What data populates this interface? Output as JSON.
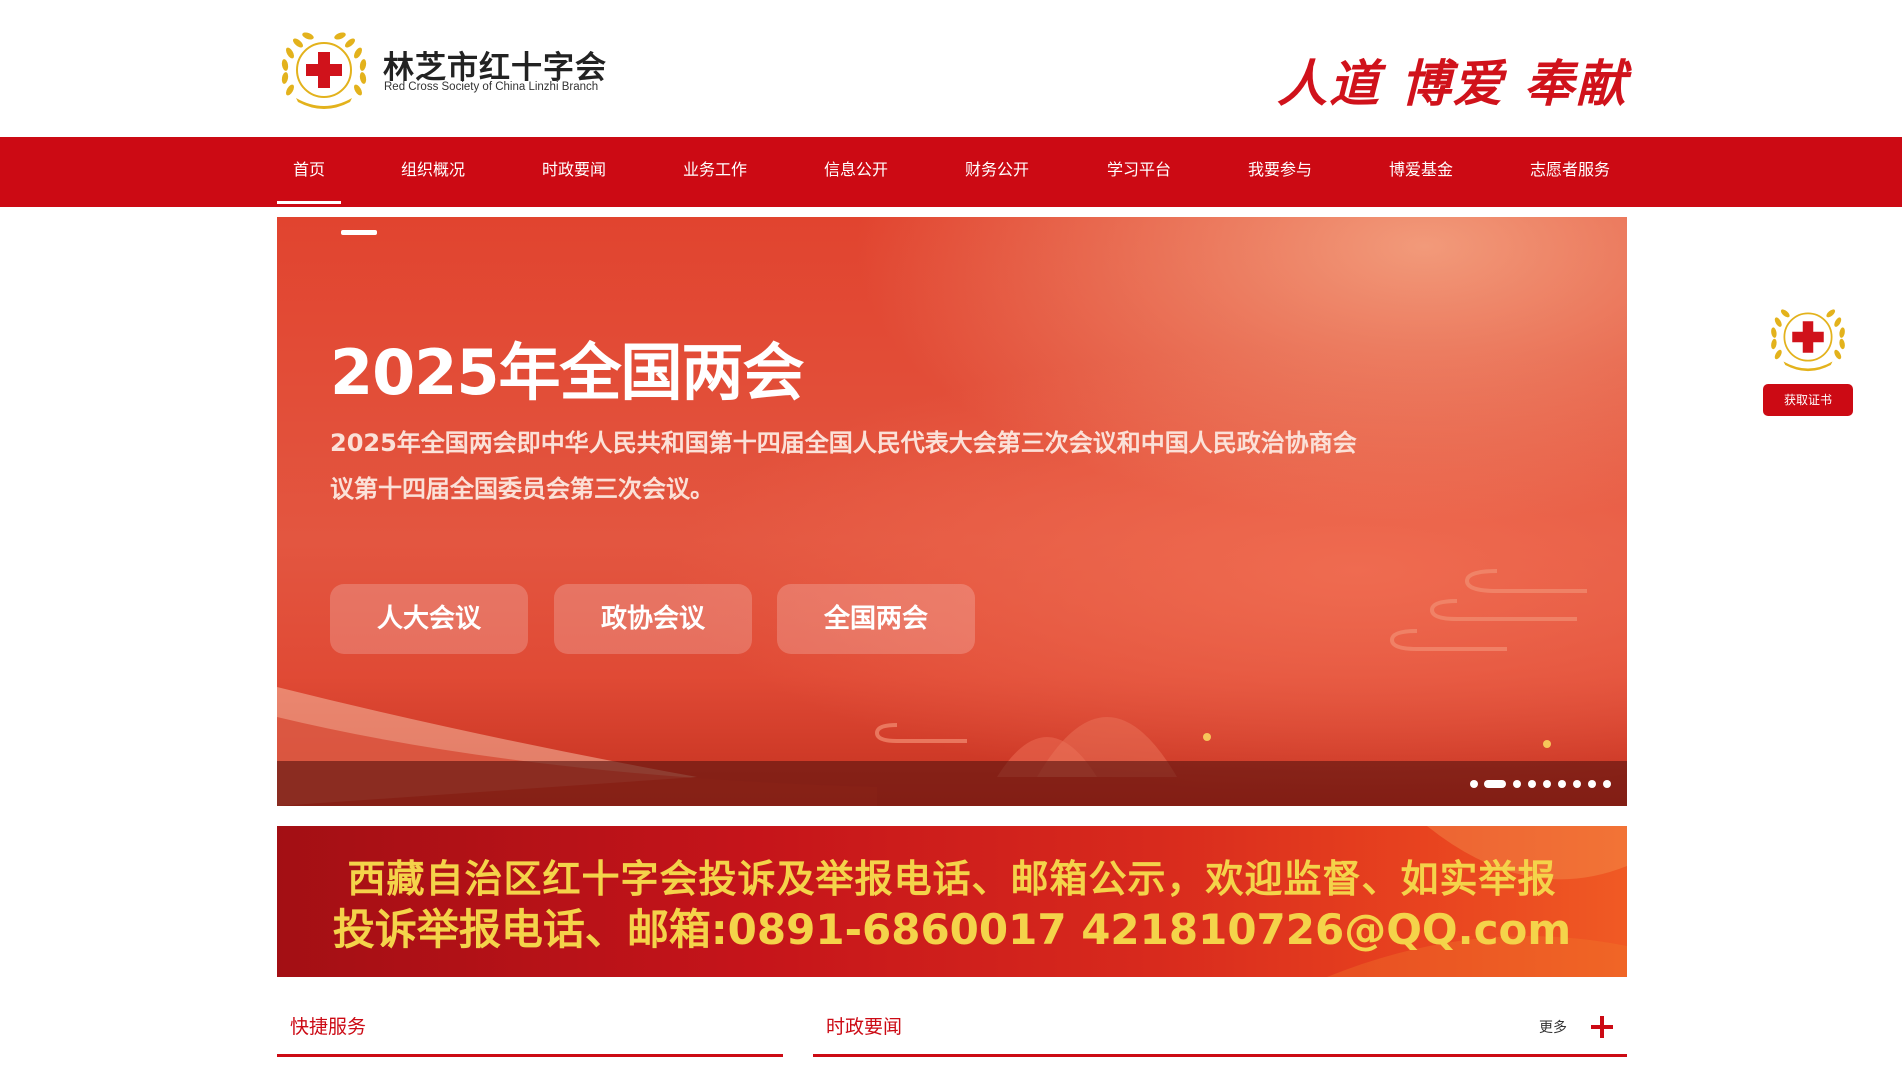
{
  "header": {
    "logo_cn": "林芝市红十字会",
    "logo_en": "Red Cross Society of China Linzhi Branch",
    "slogan": "人道 博爱 奉献"
  },
  "nav": {
    "items": [
      {
        "label": "首页",
        "active": true
      },
      {
        "label": "组织概况"
      },
      {
        "label": "时政要闻"
      },
      {
        "label": "业务工作"
      },
      {
        "label": "信息公开"
      },
      {
        "label": "财务公开"
      },
      {
        "label": "学习平台"
      },
      {
        "label": "我要参与"
      },
      {
        "label": "博爱基金"
      },
      {
        "label": "志愿者服务"
      }
    ]
  },
  "banner": {
    "title": "2025年全国两会",
    "description": "2025年全国两会即中华人民共和国第十四届全国人民代表大会第三次会议和中国人民政治协商会议第十四届全国委员会第三次会议。",
    "buttons": [
      "人大会议",
      "政协会议",
      "全国两会"
    ],
    "dot_count": 9,
    "active_dot": 2
  },
  "notice": {
    "line1": "西藏自治区红十字会投诉及举报电话、邮箱公示，欢迎监督、如实举报",
    "line2": "投诉举报电话、邮箱:0891-6860017 421810726@QQ.com"
  },
  "sections": {
    "quick_service": {
      "title": "快捷服务"
    },
    "news": {
      "title": "时政要闻",
      "more": "更多"
    }
  },
  "side_widget": {
    "button": "获取证书"
  },
  "colors": {
    "brand_red": "#cc0a14",
    "notice_text": "#f4d34a",
    "gold": "#e3b21c"
  },
  "icons": {
    "emblem": "red-cross-emblem-icon",
    "more": "plus-icon"
  }
}
